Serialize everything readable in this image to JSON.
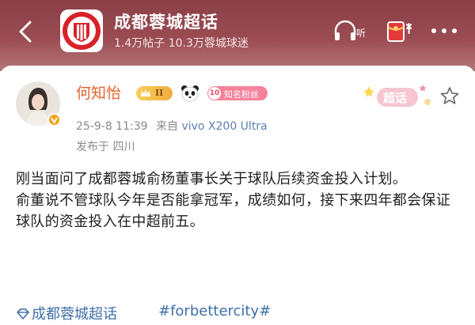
{
  "header": {
    "title": "成都蓉城超话",
    "stats": "1.4万帖子  10.3万蓉城球迷",
    "logo_text": "CHENGDU RONGCHENG"
  },
  "post": {
    "author": {
      "name": "何知怡",
      "level_badge": "II",
      "fan_badge_number": "10",
      "fan_badge_label": "知名粉丝"
    },
    "chaohua_tag": "超话",
    "date": "25-9-8 11:39",
    "source_prefix": "来自",
    "device": "vivo X200 Ultra",
    "location": "发布于 四川",
    "paragraphs": [
      "刚当面问了成都蓉城俞杨董事长关于球队后续资金投入计划。",
      "俞董说不管球队今年是否能拿冠军，成绩如何，接下来四年都会保证球队的资金投入在中超前五。"
    ],
    "topic": "成都蓉城超话",
    "hashtag": "#forbettercity#"
  },
  "colors": {
    "header_bg": "#9b4c52",
    "username": "#e8612a",
    "link": "#3e6fa8",
    "meta": "#8a8a8a"
  }
}
